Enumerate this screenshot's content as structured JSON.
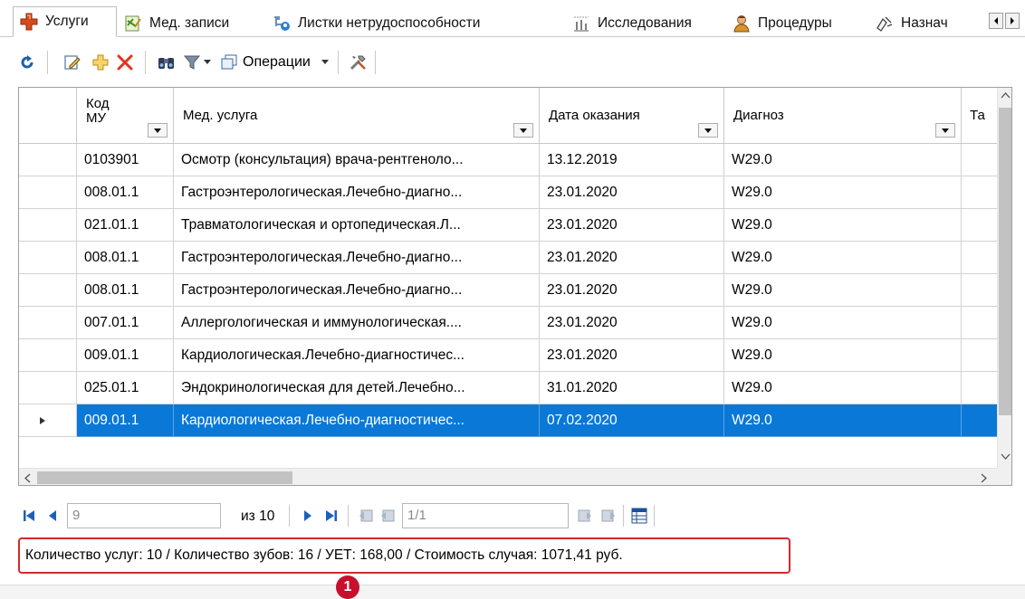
{
  "tabs": [
    {
      "label": "Услуги",
      "icon": "medical-cross-icon",
      "active": true
    },
    {
      "label": "Мед. записи",
      "icon": "notes-icon"
    },
    {
      "label": "Листки нетрудоспособности",
      "icon": "sick-leave-icon"
    },
    {
      "label": "Исследования",
      "icon": "research-icon"
    },
    {
      "label": "Процедуры",
      "icon": "procedure-icon"
    },
    {
      "label": "Назнач",
      "icon": "prescription-icon"
    }
  ],
  "toolbar": {
    "operations_label": "Операции"
  },
  "grid": {
    "columns": [
      {
        "label": "Код МУ",
        "line1": "Код",
        "line2": "МУ"
      },
      {
        "label": "Мед. услуга"
      },
      {
        "label": "Дата оказания"
      },
      {
        "label": "Диагноз"
      },
      {
        "label": "Та"
      }
    ],
    "rows": [
      {
        "code": "0103901",
        "service": "Осмотр (консультация) врача-рентгеноло...",
        "date": "13.12.2019",
        "diagnosis": "W29.0"
      },
      {
        "code": "008.01.1",
        "service": "Гастроэнтерологическая.Лечебно-диагно...",
        "date": "23.01.2020",
        "diagnosis": "W29.0"
      },
      {
        "code": "021.01.1",
        "service": "Травматологическая и ортопедическая.Л...",
        "date": "23.01.2020",
        "diagnosis": "W29.0"
      },
      {
        "code": "008.01.1",
        "service": "Гастроэнтерологическая.Лечебно-диагно...",
        "date": "23.01.2020",
        "diagnosis": "W29.0"
      },
      {
        "code": "008.01.1",
        "service": "Гастроэнтерологическая.Лечебно-диагно...",
        "date": "23.01.2020",
        "diagnosis": "W29.0"
      },
      {
        "code": "007.01.1",
        "service": "Аллергологическая и иммунологическая....",
        "date": "23.01.2020",
        "diagnosis": "W29.0"
      },
      {
        "code": "009.01.1",
        "service": "Кардиологическая.Лечебно-диагностичес...",
        "date": "23.01.2020",
        "diagnosis": "W29.0"
      },
      {
        "code": "025.01.1",
        "service": "Эндокринологическая для детей.Лечебно...",
        "date": "31.01.2020",
        "diagnosis": "W29.0"
      },
      {
        "code": "009.01.1",
        "service": "Кардиологическая.Лечебно-диагностичес...",
        "date": "07.02.2020",
        "diagnosis": "W29.0",
        "selected": true
      }
    ]
  },
  "navigator": {
    "current": "9",
    "of_label": "из 10",
    "page_box": "1/1"
  },
  "summary": {
    "text": "Количество услуг: 10 / Количество зубов: 16 / УЕТ: 168,00 / Стоимость случая: 1071,41 руб."
  },
  "badge": {
    "number": "1"
  },
  "colors": {
    "selection": "#0a78d7",
    "highlight_border": "#d22a2a",
    "badge": "#c8102e"
  }
}
